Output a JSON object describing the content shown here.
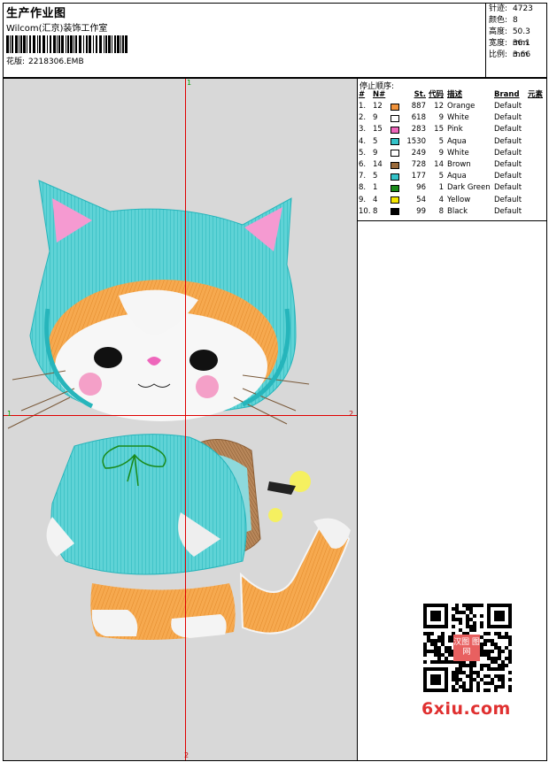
{
  "header": {
    "title": "生产作业图",
    "company": "Wilcom(汇京)装饰工作室",
    "design_label": "花版:",
    "design_file": "2218306.EMB"
  },
  "specs": [
    {
      "label": "针迹:",
      "value": "4723"
    },
    {
      "label": "颜色:",
      "value": "8"
    },
    {
      "label": "高度:",
      "value": "50.3 mm"
    },
    {
      "label": "宽度:",
      "value": "36.1 mm"
    },
    {
      "label": "比例:",
      "value": "3.66"
    }
  ],
  "design_area": {
    "marks": {
      "top": "1",
      "left": "1",
      "right": "2",
      "bottom": "2"
    }
  },
  "stop_sequence": {
    "title": "停止顺序:",
    "columns": [
      "#",
      "N#",
      "St.",
      "代码",
      "描述",
      "Brand",
      "元素"
    ],
    "rows": [
      {
        "idx": "1.",
        "needle": "12",
        "color": "#f0923a",
        "stitches": "887",
        "code": "12",
        "desc": "Orange",
        "brand": "Default"
      },
      {
        "idx": "2.",
        "needle": "9",
        "color": "#ffffff",
        "stitches": "618",
        "code": "9",
        "desc": "White",
        "brand": "Default"
      },
      {
        "idx": "3.",
        "needle": "15",
        "color": "#ee66bb",
        "stitches": "283",
        "code": "15",
        "desc": "Pink",
        "brand": "Default"
      },
      {
        "idx": "4.",
        "needle": "5",
        "color": "#33c2c8",
        "stitches": "1530",
        "code": "5",
        "desc": "Aqua",
        "brand": "Default"
      },
      {
        "idx": "5.",
        "needle": "9",
        "color": "#ffffff",
        "stitches": "249",
        "code": "9",
        "desc": "White",
        "brand": "Default"
      },
      {
        "idx": "6.",
        "needle": "14",
        "color": "#9a6a3a",
        "stitches": "728",
        "code": "14",
        "desc": "Brown",
        "brand": "Default"
      },
      {
        "idx": "7.",
        "needle": "5",
        "color": "#33c2c8",
        "stitches": "177",
        "code": "5",
        "desc": "Aqua",
        "brand": "Default"
      },
      {
        "idx": "8.",
        "needle": "1",
        "color": "#1a8a1a",
        "stitches": "96",
        "code": "1",
        "desc": "Dark Green",
        "brand": "Default"
      },
      {
        "idx": "9.",
        "needle": "4",
        "color": "#f5e600",
        "stitches": "54",
        "code": "4",
        "desc": "Yellow",
        "brand": "Default"
      },
      {
        "idx": "10.",
        "needle": "8",
        "color": "#000000",
        "stitches": "99",
        "code": "8",
        "desc": "Black",
        "brand": "Default"
      }
    ]
  },
  "watermark": {
    "qr_center_text": "汉图\n图网",
    "site": "6xiu.com"
  }
}
